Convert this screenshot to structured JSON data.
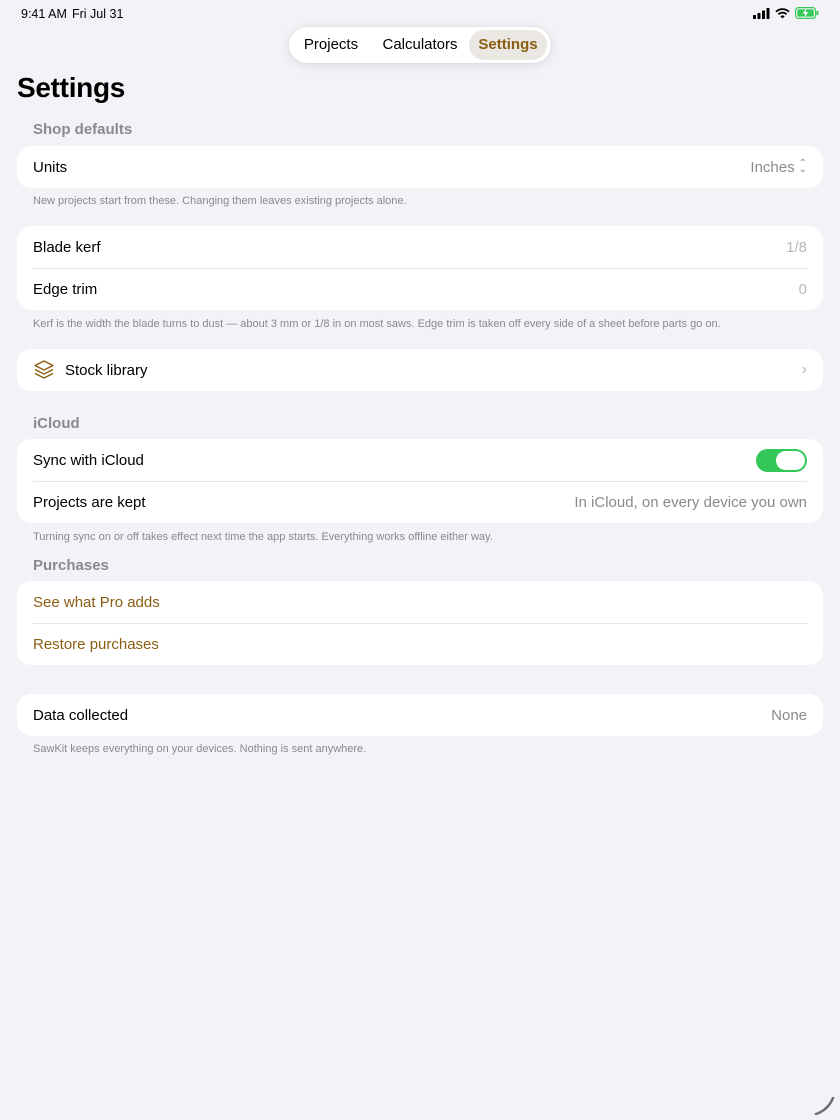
{
  "status_bar": {
    "time": "9:41 AM",
    "date": "Fri Jul 31",
    "icons": [
      "cellular-signal-icon",
      "wifi-icon",
      "battery-charging-icon"
    ]
  },
  "tabs": [
    {
      "label": "Projects",
      "selected": false
    },
    {
      "label": "Calculators",
      "selected": false
    },
    {
      "label": "Settings",
      "selected": true
    }
  ],
  "page_title": "Settings",
  "shop_defaults": {
    "header": "Shop defaults",
    "units_label": "Units",
    "units_value": "Inches",
    "footer": "New projects start from these. Changing them leaves existing projects alone."
  },
  "cutting": {
    "kerf_label": "Blade kerf",
    "kerf_placeholder": "1/8",
    "trim_label": "Edge trim",
    "trim_placeholder": "0",
    "footer": "Kerf is the width the blade turns to dust — about 3 mm or 1/8 in on most saws. Edge trim is taken off every side of a sheet before parts go on."
  },
  "stock_library": {
    "label": "Stock library",
    "icon": "stack-layers-icon"
  },
  "icloud": {
    "header": "iCloud",
    "sync_label": "Sync with iCloud",
    "sync_on": true,
    "kept_label": "Projects are kept",
    "kept_value": "In iCloud, on every device you own",
    "footer": "Turning sync on or off takes effect next time the app starts. Everything works offline either way."
  },
  "purchases": {
    "header": "Purchases",
    "pro_label": "See what Pro adds",
    "restore_label": "Restore purchases"
  },
  "privacy": {
    "data_label": "Data collected",
    "data_value": "None",
    "footer": "SawKit keeps everything on your devices. Nothing is sent anywhere."
  },
  "colors": {
    "accent": "#8a5e12",
    "toggle_on": "#34c759",
    "background": "#f2f2f7",
    "secondary_text": "#8a8a8e"
  }
}
